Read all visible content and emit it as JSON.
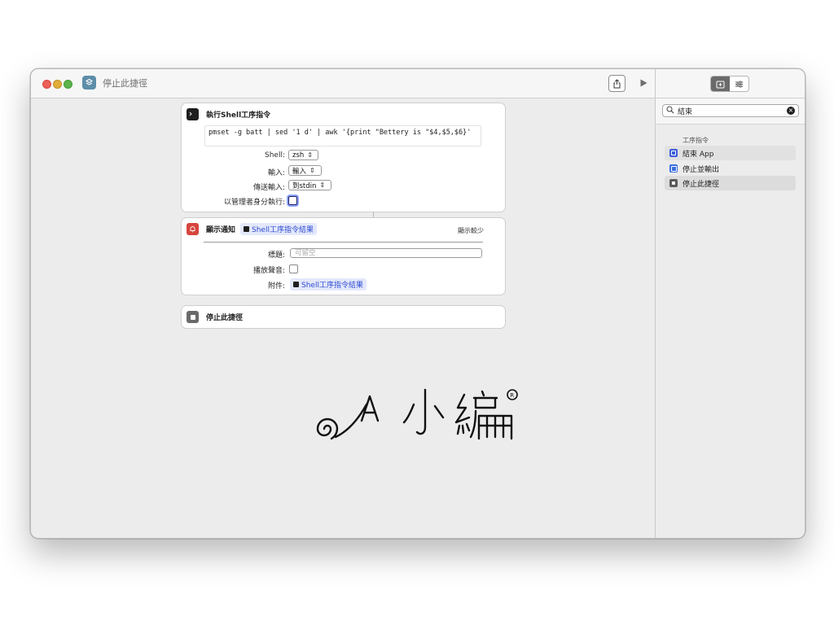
{
  "window": {
    "title": "停止此捷徑"
  },
  "actions": {
    "shell": {
      "title": "執行Shell工序指令",
      "script": "pmset -g batt | sed '1 d' | awk '{print \"Bettery is \"$4,$5,$6}'",
      "shell_label": "Shell:",
      "shell_value": "zsh",
      "input_label": "輸入:",
      "input_value": "輸入",
      "pass_input_label": "傳送輸入:",
      "pass_input_value": "到stdin",
      "run_as_admin_label": "以管理者身分執行:"
    },
    "notification": {
      "title": "顯示通知",
      "token": "Shell工序指令結果",
      "show_less": "顯示較少",
      "title_label": "標題:",
      "title_placeholder": "可留空",
      "play_sound_label": "播放聲音:",
      "attachment_label": "附件:",
      "attachment_value": "Shell工序指令結果"
    },
    "stop": {
      "title": "停止此捷徑"
    }
  },
  "sidebar": {
    "search_value": "結束",
    "section_title": "工序指令",
    "items": [
      {
        "label": "結束 App",
        "icon": "app-quit-icon",
        "color": "#3b5bdb"
      },
      {
        "label": "停止並輸出",
        "icon": "stop-output-icon",
        "color": "#3b6fe0"
      },
      {
        "label": "停止此捷徑",
        "icon": "stop-icon",
        "color": "#5a5a5a"
      }
    ]
  },
  "colors": {
    "shell_icon": "#1e1e1e",
    "notification_icon": "#d6453d",
    "stop_icon": "#6a6a6a",
    "token_bg": "#e3e8fb",
    "token_text": "#2f4bd0"
  }
}
